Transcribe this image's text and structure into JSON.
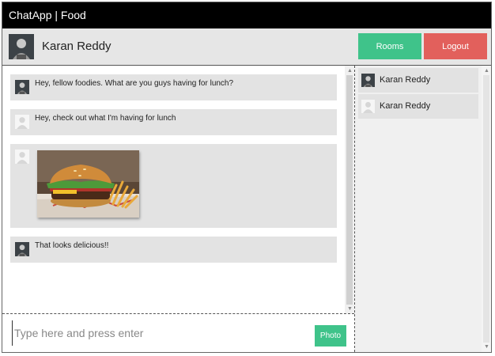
{
  "app": {
    "title": "ChatApp | Food"
  },
  "header": {
    "user_name": "Karan Reddy",
    "rooms_label": "Rooms",
    "logout_label": "Logout",
    "avatar_icon": "user-dark-avatar-icon"
  },
  "colors": {
    "title_bg": "#000000",
    "rooms_button": "#3fc38a",
    "logout_button": "#e2605c",
    "photo_button": "#3fc38a",
    "message_bg": "#e3e3e3"
  },
  "messages": [
    {
      "avatar": "user-dark-avatar-icon",
      "text": "Hey, fellow foodies. What are you guys having for lunch?"
    },
    {
      "avatar": "user-default-avatar-icon",
      "text": "Hey, check out what I'm having for lunch"
    },
    {
      "avatar": "user-default-avatar-icon",
      "image": "burger-and-fries-photo"
    },
    {
      "avatar": "user-dark-avatar-icon",
      "text": "That looks delicious!!"
    }
  ],
  "online_users": [
    {
      "name": "Karan Reddy",
      "avatar": "user-dark-avatar-icon"
    },
    {
      "name": "Karan Reddy",
      "avatar": "user-default-avatar-icon"
    }
  ],
  "composer": {
    "placeholder": "Type here and press enter",
    "photo_label": "Photo"
  }
}
